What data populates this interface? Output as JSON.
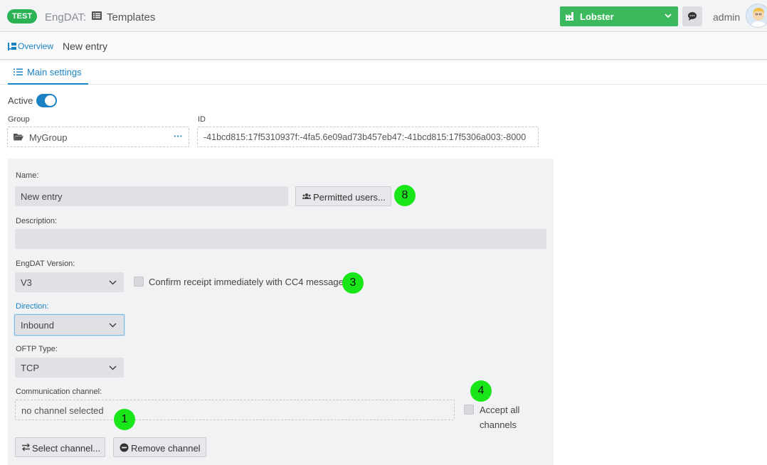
{
  "header": {
    "env_badge": "TEST",
    "app_name": "EngDAT:",
    "page_name": "Templates",
    "company": "Lobster",
    "user": "admin"
  },
  "breadcrumb": {
    "overview": "Overview",
    "current": "New entry"
  },
  "tabs": [
    {
      "label": "Main settings",
      "icon": "list-icon"
    }
  ],
  "form": {
    "active_label": "Active",
    "active": true,
    "group_label": "Group",
    "group_value": "MyGroup",
    "group_more": "···",
    "id_label": "ID",
    "id_value": "-41bcd815:17f5310937f:-4fa5.6e09ad73b457eb47:-41bcd815:17f5306a003:-8000",
    "name_label": "Name:",
    "name_value": "New entry",
    "permitted_users_button": "Permitted users...",
    "description_label": "Description:",
    "description_value": "",
    "version_label": "EngDAT Version:",
    "version_value": "V3",
    "confirm_label": "Confirm receipt immediately with CC4 message",
    "direction_label": "Direction:",
    "direction_value": "Inbound",
    "oftp_label": "OFTP Type:",
    "oftp_value": "TCP",
    "channel_label": "Communication channel:",
    "channel_value": "no channel selected",
    "accept_all_line1": "Accept all",
    "accept_all_line2": "channels",
    "select_channel_button": "Select channel...",
    "remove_channel_button": "Remove channel"
  },
  "markers": [
    "8",
    "3",
    "4",
    "1"
  ],
  "colors": {
    "accent": "#1a82c4",
    "env_badge": "#2ab255",
    "company_button": "#3cb95c",
    "marker": "#19e619"
  }
}
